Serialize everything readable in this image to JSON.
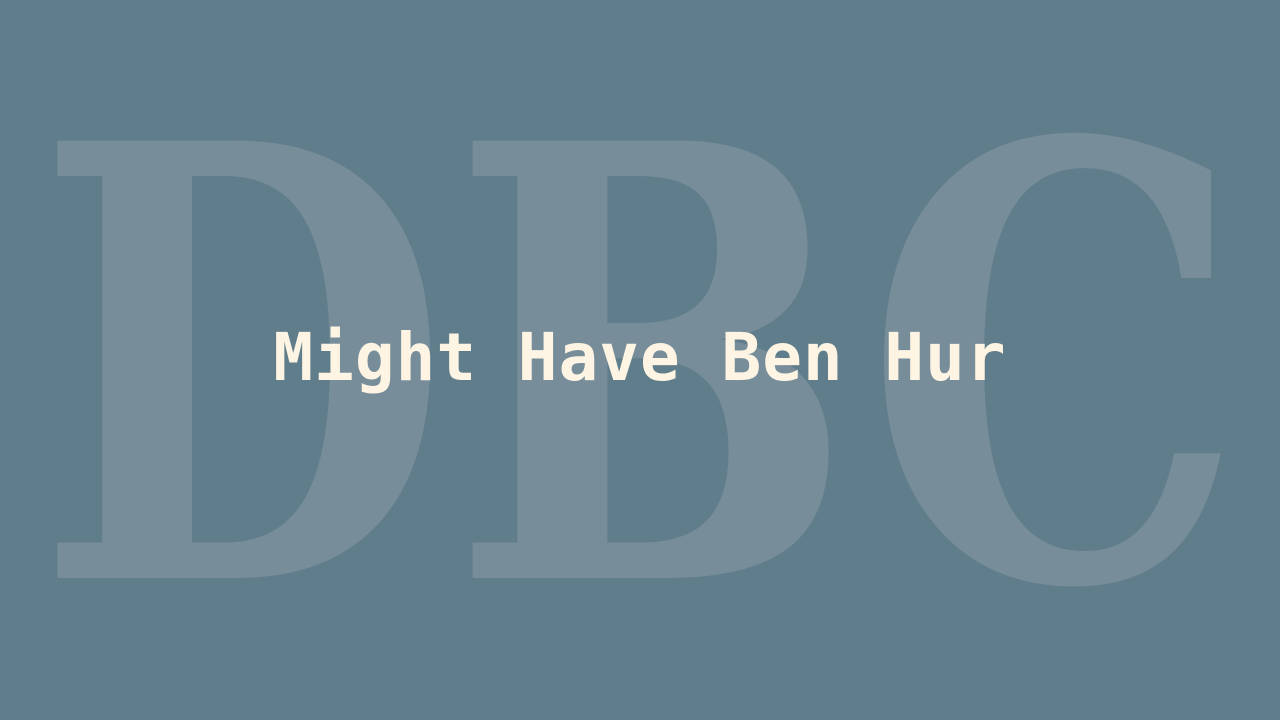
{
  "background_color": "#607d8b",
  "watermark": {
    "text": "DBC",
    "color": "#778d9a"
  },
  "title": {
    "text": "Might Have Ben Hur",
    "color": "#fdf4e3"
  }
}
